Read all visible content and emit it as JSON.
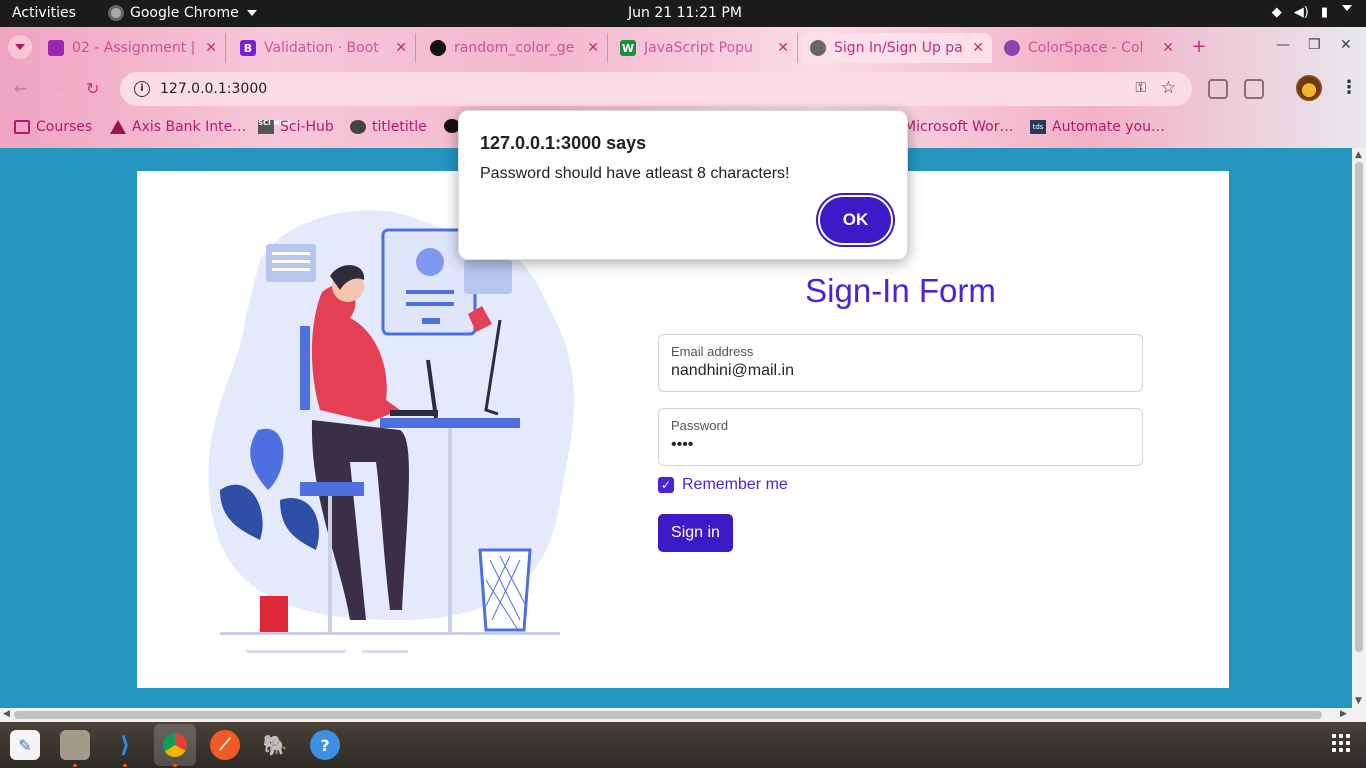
{
  "system": {
    "activities": "Activities",
    "app_name": "Google Chrome",
    "clock": "Jun 21  11:21 PM"
  },
  "tabs": [
    {
      "label": "02 - Assignment |",
      "icon_color": "#9c27b0",
      "icon_glyph": ""
    },
    {
      "label": "Validation · Boot",
      "icon_color": "#7a1fd6",
      "icon_glyph": "B"
    },
    {
      "label": "random_color_ge",
      "icon_color": "#111111",
      "icon_glyph": ""
    },
    {
      "label": "JavaScript Popu",
      "icon_color": "#1a8f3c",
      "icon_glyph": "W"
    },
    {
      "label": "Sign In/Sign Up pa",
      "icon_color": "#666666",
      "icon_glyph": ""
    },
    {
      "label": "ColorSpace - Col",
      "icon_color": "#8e44ad",
      "icon_glyph": ""
    }
  ],
  "address_bar": {
    "url": "127.0.0.1:3000"
  },
  "bookmarks": [
    {
      "label": "Courses",
      "icon": "folder-icon"
    },
    {
      "label": "Axis Bank Inte…",
      "icon": "axis-bank-icon"
    },
    {
      "label": "Sci-Hub",
      "icon": "sci-hub-icon"
    },
    {
      "label": "titletitle",
      "icon": "globe-icon"
    },
    {
      "label": "",
      "icon": "github-icon"
    },
    {
      "label": "Microsoft Wor…",
      "icon": "microsoft-icon"
    },
    {
      "label": "Automate you…",
      "icon": "tds-icon"
    }
  ],
  "dialog": {
    "title": "127.0.0.1:3000 says",
    "message": "Password should have atleast 8 characters!",
    "ok_label": "OK"
  },
  "form": {
    "title": "Sign-In Form",
    "email_label": "Email address",
    "email_value": "nandhini@mail.in",
    "password_label": "Password",
    "password_value": "••••",
    "remember_label": "Remember me",
    "remember_checked": true,
    "submit_label": "Sign in"
  },
  "colors": {
    "page_background": "#2596be",
    "accent": "#4b22d9",
    "button": "#3a1bc7"
  },
  "dock": [
    "text-editor-icon",
    "files-icon",
    "vscode-icon",
    "chrome-icon",
    "postman-icon",
    "pgadmin-icon",
    "help-icon"
  ]
}
